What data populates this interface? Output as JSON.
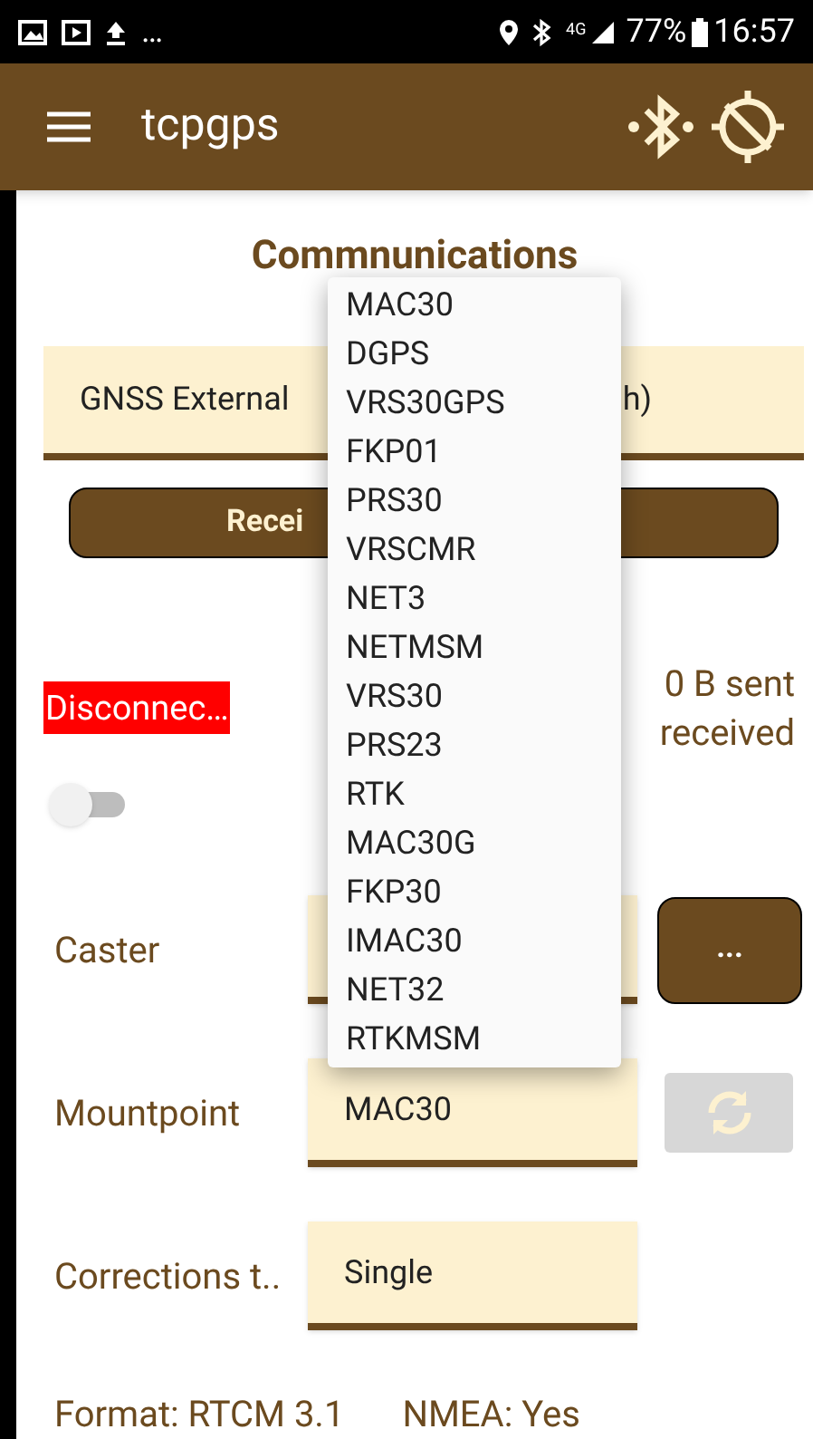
{
  "status_bar": {
    "overflow": "…",
    "network": "4G",
    "battery": "77%",
    "time": "16:57"
  },
  "app_bar": {
    "title": "tcpgps"
  },
  "section_title": "Commnunications",
  "device_field": {
    "value_start": "GNSS External",
    "value_end": "h)"
  },
  "receiver_button": {
    "label": "Recei"
  },
  "connection": {
    "status": "Disconnec…",
    "sent": "0 B sent",
    "received": "received",
    "toggle_on": false
  },
  "caster": {
    "label": "Caster",
    "button": "..."
  },
  "mountpoint": {
    "label": "Mountpoint",
    "value": "MAC30",
    "refresh_disabled": true
  },
  "corrections": {
    "label": "Corrections t..",
    "value": "Single"
  },
  "footer": {
    "format": "Format: RTCM 3.1",
    "nmea": "NMEA: Yes"
  },
  "dropdown": [
    "MAC30",
    "DGPS",
    "VRS30GPS",
    "FKP01",
    "PRS30",
    "VRSCMR",
    "NET3",
    "NETMSM",
    "VRS30",
    "PRS23",
    "RTK",
    "MAC30G",
    "FKP30",
    "IMAC30",
    "NET32",
    "RTKMSM"
  ]
}
